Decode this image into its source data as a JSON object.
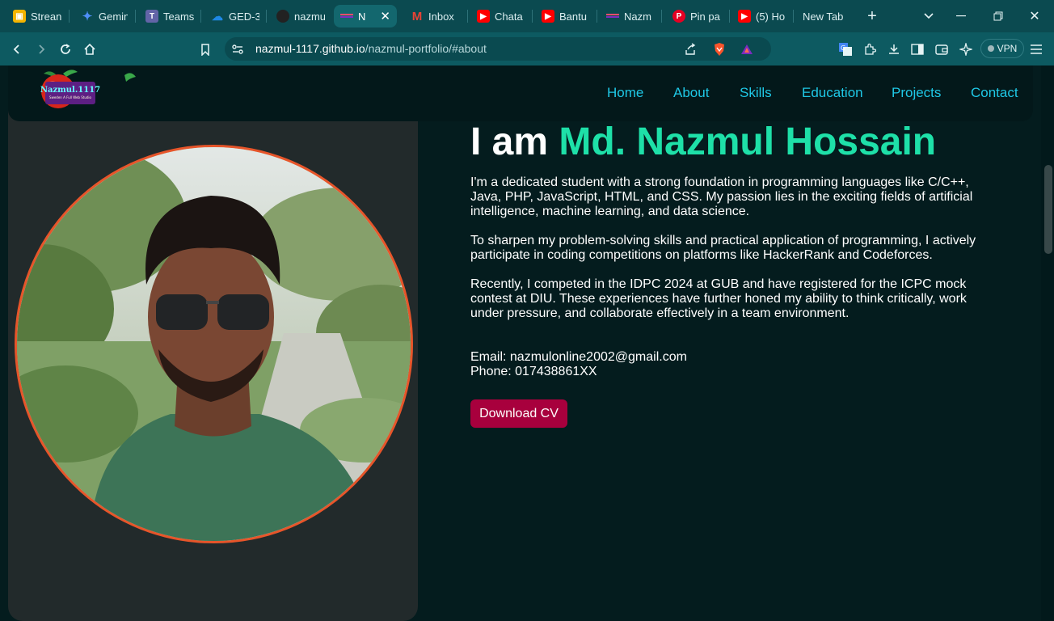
{
  "browser": {
    "tabs": [
      {
        "label": "Strean",
        "icon": "classroom-icon",
        "color": "#f4b400"
      },
      {
        "label": "Gemin",
        "icon": "gemini-icon",
        "color": "#4f8ff7"
      },
      {
        "label": "Teams",
        "icon": "teams-icon",
        "color": "#6264a7"
      },
      {
        "label": "GED-3",
        "icon": "onedrive-icon",
        "color": "#1e88e5"
      },
      {
        "label": "nazmu",
        "icon": "github-icon",
        "color": "#222222"
      },
      {
        "label": "N",
        "icon": "portfolio-icon",
        "color": "#7b2cbf"
      },
      {
        "label": "Inbox",
        "icon": "gmail-icon",
        "color": "#ea4335"
      },
      {
        "label": "Chata",
        "icon": "youtube-icon",
        "color": "#ff0000"
      },
      {
        "label": "Bantu",
        "icon": "youtube-icon",
        "color": "#ff0000"
      },
      {
        "label": "Nazm",
        "icon": "portfolio-icon",
        "color": "#7b2cbf"
      },
      {
        "label": "Pin pa",
        "icon": "pinterest-icon",
        "color": "#e60023"
      },
      {
        "label": "(5) Ho",
        "icon": "youtube-icon",
        "color": "#ff0000"
      },
      {
        "label": "New Tab",
        "icon": "",
        "color": ""
      }
    ],
    "url_host": "nazmul-1117.github.io",
    "url_path": "/nazmul-portfolio/#about",
    "vpn_label": "VPN"
  },
  "site": {
    "logo": {
      "title": "Nazmul.1117",
      "tagline": "Sweden A Full Web Studio"
    },
    "nav": [
      "Home",
      "About",
      "Skills",
      "Education",
      "Projects",
      "Contact"
    ],
    "heading_prefix": "I am",
    "heading_name": "Md. Nazmul Hossain",
    "paragraphs": [
      "I'm a dedicated student with a strong foundation in programming languages like C/C++, Java, PHP, JavaScript, HTML, and CSS. My passion lies in the exciting fields of artificial intelligence, machine learning, and data science.",
      "To sharpen my problem-solving skills and practical application of programming, I actively participate in coding competitions on platforms like HackerRank and Codeforces.",
      "Recently, I competed in the IDPC 2024 at GUB and have registered for the ICPC mock contest at DIU. These experiences have further honed my ability to think critically, work under pressure, and collaborate effectively in a team environment."
    ],
    "email": "Email: nazmulonline2002@gmail.com",
    "phone": "Phone: 017438861XX",
    "cv_button": "Download CV"
  },
  "colors": {
    "accent": "#1ee0a8",
    "nav_link": "#1fc8e6",
    "cv_button": "#a8003d",
    "portrait_ring": "#e7552a"
  }
}
